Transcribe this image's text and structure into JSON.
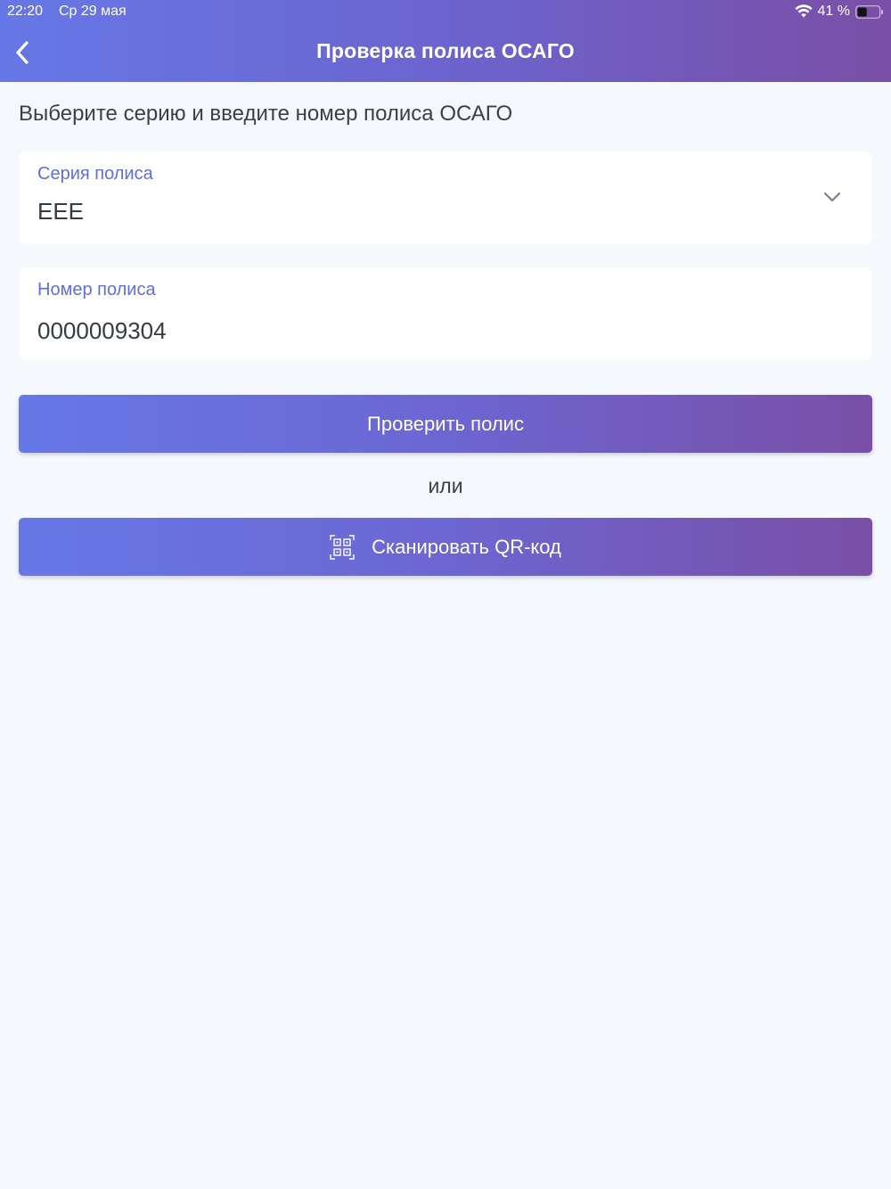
{
  "status_bar": {
    "time": "22:20",
    "date": "Ср 29 мая",
    "battery": "41 %"
  },
  "nav": {
    "title": "Проверка полиса ОСАГО"
  },
  "instruction": "Выберите серию и введите номер полиса ОСАГО",
  "series_field": {
    "label": "Серия полиса",
    "value": "ЕЕЕ"
  },
  "number_field": {
    "label": "Номер полиса",
    "value": "0000009304"
  },
  "check_button": {
    "label": "Проверить полис"
  },
  "or_text": "или",
  "scan_button": {
    "label": "Сканировать QR-код"
  },
  "colors": {
    "accent": "#5d6fe0",
    "gradient_start": "#6678e6",
    "gradient_end": "#7a4fa6",
    "background": "#f5f8fc"
  },
  "icons": [
    "back-icon",
    "wifi-icon",
    "battery-icon",
    "chevron-down-icon",
    "qr-code-icon"
  ]
}
